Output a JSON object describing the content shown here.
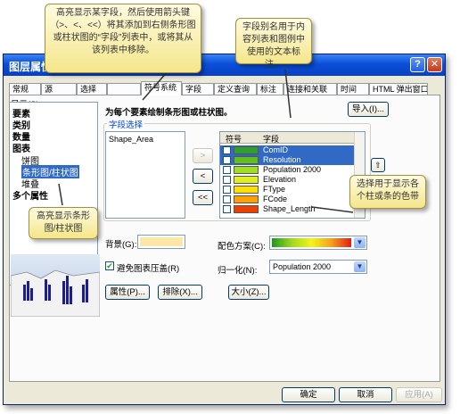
{
  "window": {
    "title": "图层属性",
    "help": "?",
    "close": "✕"
  },
  "tabs": [
    "常规",
    "源",
    "选择",
    "",
    "符号系统",
    "字段",
    "定义查询",
    "标注",
    "连接和关联",
    "时间",
    "HTML 弹出窗口"
  ],
  "show_label": "显示(S):",
  "tree": {
    "items": [
      "要素",
      "类别",
      "数量",
      "图表",
      "饼图",
      "条形图/柱状图",
      "堆叠",
      "多个属性"
    ]
  },
  "panel_heading": "为每个要素绘制条形图或柱状图。",
  "import_button": "导入(I)...",
  "field_select_legend": "字段选择",
  "available_fields": [
    "Shape_Area"
  ],
  "move_buttons": [
    ">",
    "<",
    "<<"
  ],
  "grid": {
    "headers": [
      "符号",
      "字段"
    ],
    "rows": [
      {
        "name": "ComID",
        "color": "#2fa02f",
        "selected": true
      },
      {
        "name": "Resolution",
        "color": "#5fbf1f",
        "selected": true
      },
      {
        "name": "Population 2000",
        "color": "#9fdf1f",
        "selected": false
      },
      {
        "name": "Elevation",
        "color": "#dfef1f",
        "selected": false
      },
      {
        "name": "FType",
        "color": "#ffdf00",
        "selected": false
      },
      {
        "name": "FCode",
        "color": "#ff9f00",
        "selected": false
      },
      {
        "name": "Shape_Length",
        "color": "#ef3f00",
        "selected": false
      }
    ]
  },
  "background_label": "背景(G):",
  "background_color": "#fce6a8",
  "color_scheme_label": "配色方案(C):",
  "avoid_overlap_label": "避免图表压盖(R)",
  "normalize_label": "归一化(N):",
  "normalize_value": "Population 2000",
  "buttons": {
    "properties": "属性(P)...",
    "exclude": "排除(X)...",
    "size": "大小(Z)..."
  },
  "footer": {
    "ok": "确定",
    "cancel": "取消",
    "apply": "应用(A)"
  },
  "callouts": {
    "c1": "高亮显示某字段，然后使用箭头键（>、<、<<）将其添加到右侧条形图或柱状图的“字段”列表中，或将其从该列表中移除。",
    "c2": "字段别名用于内容列表和图例中使用的文本标注。",
    "c3": "选择用于显示各个柱或条的色带",
    "c4": "高亮显示条形图/柱状图"
  }
}
